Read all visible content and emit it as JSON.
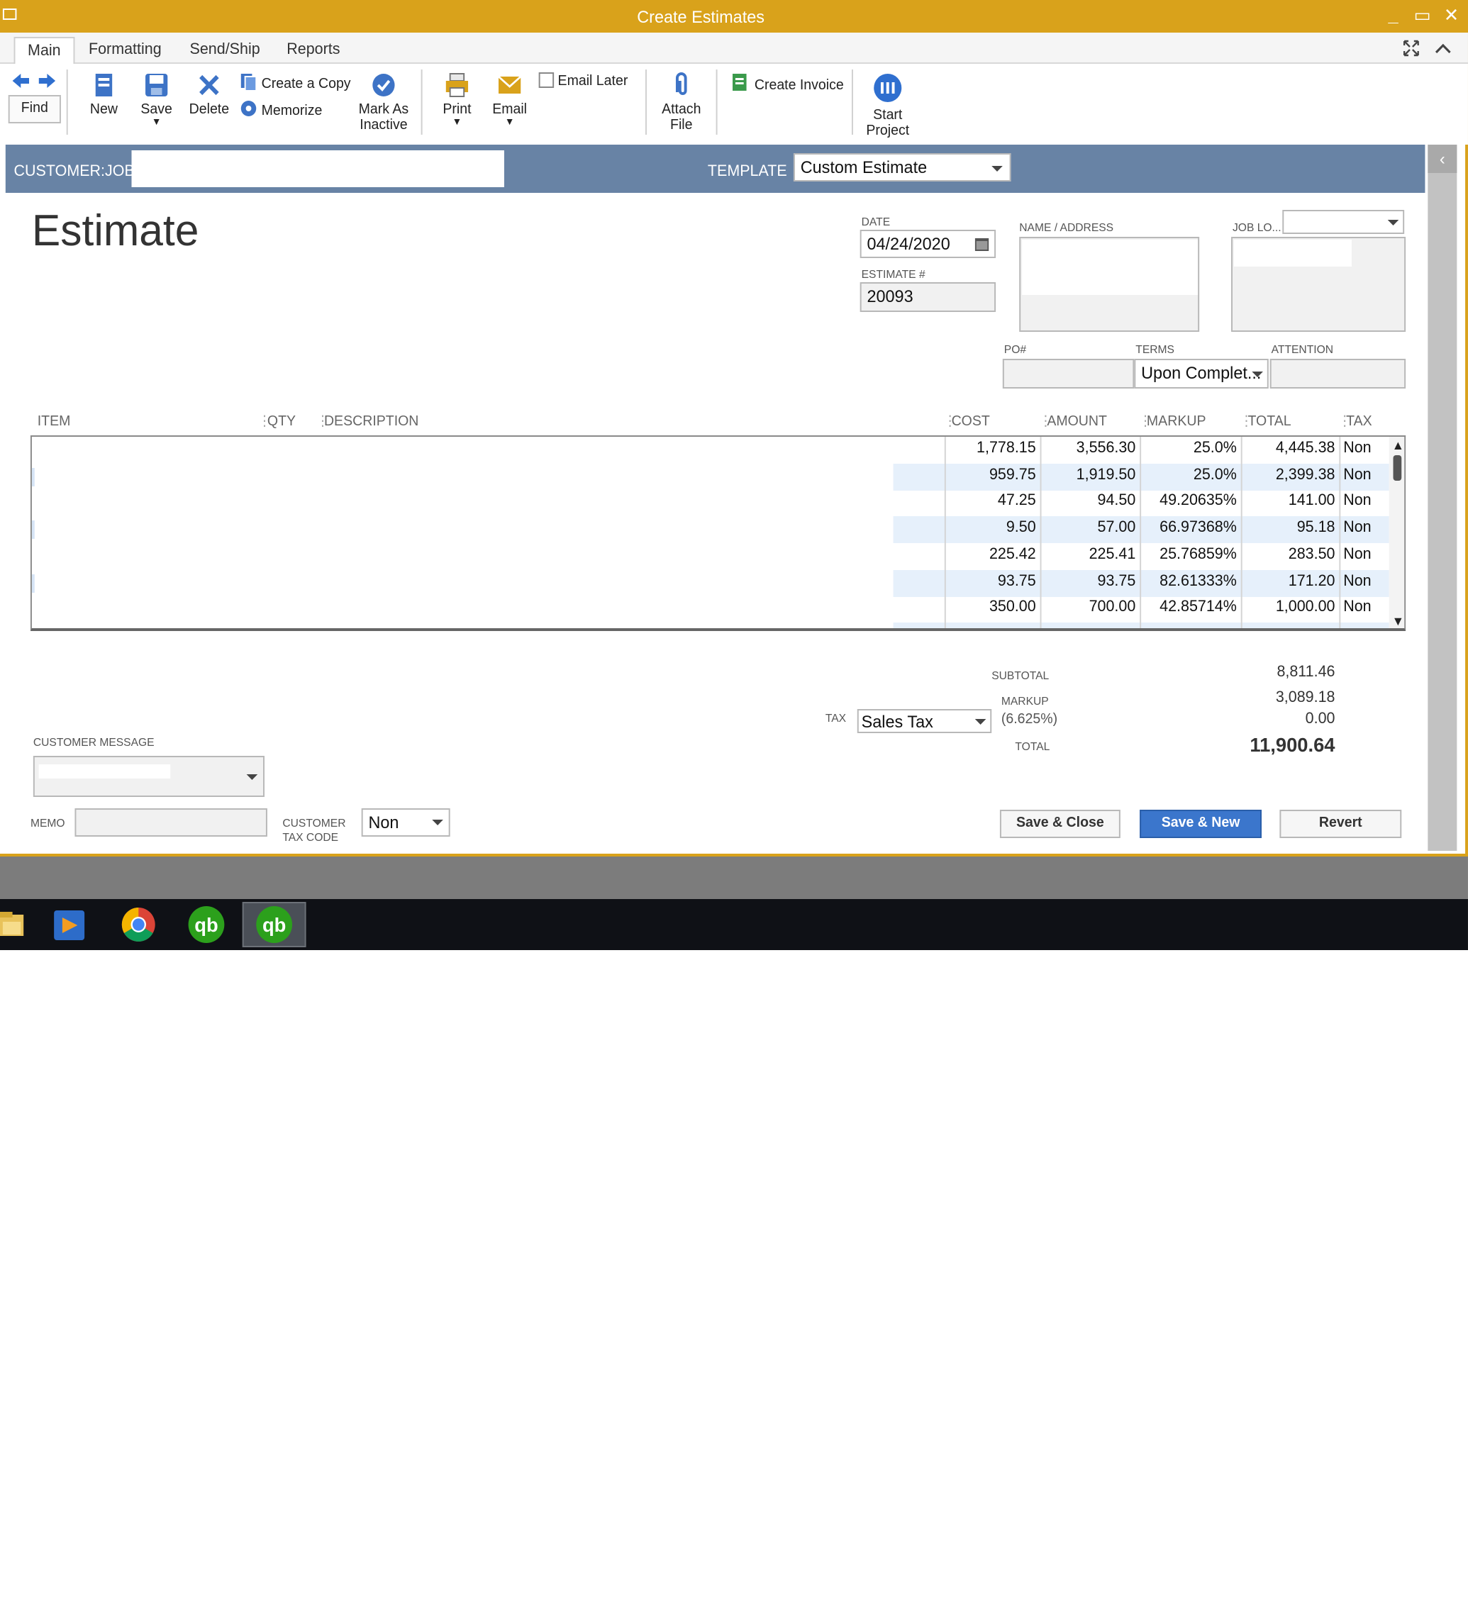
{
  "window": {
    "title": "Create Estimates"
  },
  "tabs": [
    "Main",
    "Formatting",
    "Send/Ship",
    "Reports"
  ],
  "toolbar": {
    "find": "Find",
    "new": "New",
    "save": "Save",
    "delete": "Delete",
    "create_copy": "Create a Copy",
    "memorize": "Memorize",
    "mark_inactive_1": "Mark As",
    "mark_inactive_2": "Inactive",
    "print": "Print",
    "email": "Email",
    "email_later": "Email Later",
    "attach_1": "Attach",
    "attach_2": "File",
    "create_invoice": "Create Invoice",
    "start_project_1": "Start",
    "start_project_2": "Project"
  },
  "customer": {
    "label": "CUSTOMER:JOB",
    "value": ""
  },
  "template": {
    "label": "TEMPLATE",
    "value": "Custom Estimate"
  },
  "form": {
    "title": "Estimate",
    "date_label": "DATE",
    "date": "04/24/2020",
    "estimate_label": "ESTIMATE #",
    "estimate_no": "20093",
    "name_address_label": "NAME / ADDRESS",
    "job_location_label": "JOB LO...",
    "po_label": "PO#",
    "po": "",
    "terms_label": "TERMS",
    "terms": "Upon Complet...",
    "attention_label": "ATTENTION",
    "attention": ""
  },
  "grid": {
    "headers": {
      "item": "ITEM",
      "qty": "QTY",
      "description": "DESCRIPTION",
      "cost": "COST",
      "amount": "AMOUNT",
      "markup": "MARKUP",
      "total": "TOTAL",
      "tax": "TAX"
    },
    "rows": [
      {
        "cost": "1,778.15",
        "amount": "3,556.30",
        "markup": "25.0%",
        "total": "4,445.38",
        "tax": "Non"
      },
      {
        "cost": "959.75",
        "amount": "1,919.50",
        "markup": "25.0%",
        "total": "2,399.38",
        "tax": "Non"
      },
      {
        "cost": "47.25",
        "amount": "94.50",
        "markup": "49.20635%",
        "total": "141.00",
        "tax": "Non"
      },
      {
        "cost": "9.50",
        "amount": "57.00",
        "markup": "66.97368%",
        "total": "95.18",
        "tax": "Non"
      },
      {
        "cost": "225.42",
        "amount": "225.41",
        "markup": "25.76859%",
        "total": "283.50",
        "tax": "Non"
      },
      {
        "cost": "93.75",
        "amount": "93.75",
        "markup": "82.61333%",
        "total": "171.20",
        "tax": "Non"
      },
      {
        "cost": "350.00",
        "amount": "700.00",
        "markup": "42.85714%",
        "total": "1,000.00",
        "tax": "Non"
      }
    ]
  },
  "totals": {
    "subtotal_label": "SUBTOTAL",
    "subtotal": "8,811.46",
    "markup_label": "MARKUP",
    "markup": "3,089.18",
    "tax_rate": "(6.625%)",
    "tax_amount": "0.00",
    "total_label": "TOTAL",
    "total": "11,900.64",
    "tax_label": "TAX",
    "tax_item": "Sales Tax"
  },
  "footer": {
    "customer_message_label": "CUSTOMER MESSAGE",
    "memo_label": "MEMO",
    "memo": "",
    "customer_tax_code_label_1": "CUSTOMER",
    "customer_tax_code_label_2": "TAX CODE",
    "customer_tax_code": "Non",
    "save_close": "Save & Close",
    "save_new": "Save & New",
    "revert": "Revert"
  },
  "colors": {
    "title_bar": "#d9a21b",
    "band": "#6883a5",
    "primary_button": "#3b76cc",
    "row_shade": "#e6f0fb"
  },
  "taskbar": {
    "icons": [
      "file-explorer-icon",
      "media-player-icon",
      "chrome-icon",
      "quickbooks-icon",
      "quickbooks-active-icon"
    ]
  }
}
